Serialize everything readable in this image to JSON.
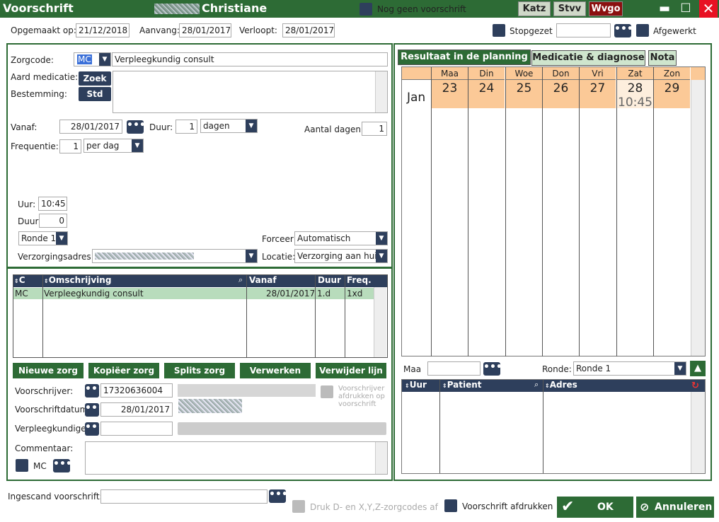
{
  "titlebar": {
    "title": "Voorschrift",
    "patient_name": "Christiane",
    "no_prescription_label": "Nog geen voorschrift",
    "buttons": [
      "Katz",
      "Stvv",
      "Wvgo"
    ]
  },
  "header": {
    "opgemaakt_label": "Opgemaakt op:",
    "opgemaakt_value": "21/12/2018",
    "aanvang_label": "Aanvang:",
    "aanvang_value": "28/01/2017",
    "verloopt_label": "Verloopt:",
    "verloopt_value": "28/01/2017",
    "stopgezet_label": "Stopgezet",
    "stopgezet_value": "",
    "afgewerkt_label": "Afgewerkt"
  },
  "form": {
    "zorgcode_label": "Zorgcode:",
    "zorgcode_code": "MC",
    "zorgcode_desc": "Verpleegkundig consult",
    "aard_label": "Aard medicatie:",
    "zoek_btn": "Zoek",
    "bestemming_label": "Bestemming:",
    "std_btn": "Std",
    "vanaf_label": "Vanaf:",
    "vanaf_value": "28/01/2017",
    "duur_label": "Duur:",
    "duur_value": "1",
    "duur_unit": "dagen",
    "aantal_label": "Aantal dagen:",
    "aantal_value": "1",
    "freq_label": "Frequentie:",
    "freq_value": "1",
    "freq_unit": "per dag",
    "uur_label": "Uur:",
    "uur_value": "10:45",
    "duur2_label": "Duur",
    "duur2_value": "0",
    "ronde_value": "Ronde 1",
    "forceer_label": "Forceer",
    "forceer_value": "Automatisch",
    "adres_label": "Verzorgingsadres:",
    "locatie_label": "Locatie:",
    "locatie_value": "Verzorging aan huis"
  },
  "grid": {
    "headers": [
      "C",
      "Omschrijving",
      "Vanaf",
      "Duur",
      "Freq."
    ],
    "rows": [
      [
        "MC",
        "Verpleegkundig consult",
        "28/01/2017",
        "1.d",
        "1xd"
      ]
    ]
  },
  "actions": [
    "Nieuwe zorg",
    "Kopiëer zorg",
    "Splits zorg",
    "Verwerken",
    "Verwijder lijn"
  ],
  "prescriber": {
    "voorschrijver_label": "Voorschrijver:",
    "voorschrijver_value": "17320636004",
    "print_label": "Voorschrijver afdrukken op voorschrift",
    "datum_label": "Voorschriftdatum:",
    "datum_value": "28/01/2017",
    "verpleeg_label": "Verpleegkundige:",
    "commentaar_label": "Commentaar:",
    "mc_label": "MC"
  },
  "tabs": [
    "Resultaat in de planning",
    "Medicatie & diagnose",
    "Nota"
  ],
  "calendar": {
    "month": "Jan",
    "days": [
      {
        "name": "Maa",
        "num": "23",
        "time": ""
      },
      {
        "name": "Din",
        "num": "24",
        "time": ""
      },
      {
        "name": "Woe",
        "num": "25",
        "time": ""
      },
      {
        "name": "Don",
        "num": "26",
        "time": ""
      },
      {
        "name": "Vri",
        "num": "27",
        "time": ""
      },
      {
        "name": "Zat",
        "num": "28",
        "time": "10:45"
      },
      {
        "name": "Zon",
        "num": "29",
        "time": ""
      }
    ]
  },
  "planning": {
    "day_label": "Maa",
    "ronde_label": "Ronde:",
    "ronde_value": "Ronde 1",
    "headers": [
      "Uur",
      "Patient",
      "Adres"
    ]
  },
  "footer": {
    "ingescand_label": "Ingescand voorschrift:",
    "druk_label": "Druk D- en X,Y,Z-zorgcodes af",
    "afdrukken_label": "Voorschrift afdrukken",
    "ok_label": "OK",
    "annuleren_label": "Annuleren"
  },
  "colors": {
    "green": "#2d6b35",
    "navy": "#2e3f5c",
    "calendar": "#fbc997",
    "wvgo": "#8b1010"
  }
}
